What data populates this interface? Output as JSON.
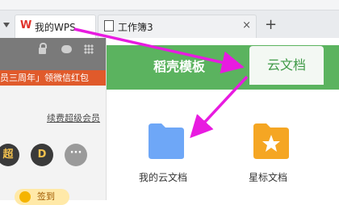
{
  "tabs": [
    {
      "label": "我的WPS",
      "close": "×",
      "icon": "wps-logo-icon"
    },
    {
      "label": "工作簿3",
      "close": "×",
      "icon": "spreadsheet-icon"
    }
  ],
  "new_tab": "+",
  "sidebar": {
    "banner_text": "员三周年」领微信红包",
    "renew_link": "续费超级会员",
    "quick_icons": [
      {
        "label": "超",
        "icon": "super-member-icon"
      },
      {
        "label": "D",
        "icon": "docer-icon"
      },
      {
        "label": "···",
        "icon": "more-icon"
      }
    ],
    "signin_label": "签到"
  },
  "main": {
    "logo_text": "稻壳模板",
    "cloud_tab": "云文档",
    "folders": [
      {
        "label": "我的云文档",
        "icon": "blue-folder-icon"
      },
      {
        "label": "星标文档",
        "icon": "star-folder-icon"
      }
    ]
  },
  "colors": {
    "green": "#5bb35f",
    "arrow": "#e81be0",
    "banner": "#e05a2b",
    "blue_folder": "#6ea7f7",
    "orange_folder": "#f5a623"
  }
}
